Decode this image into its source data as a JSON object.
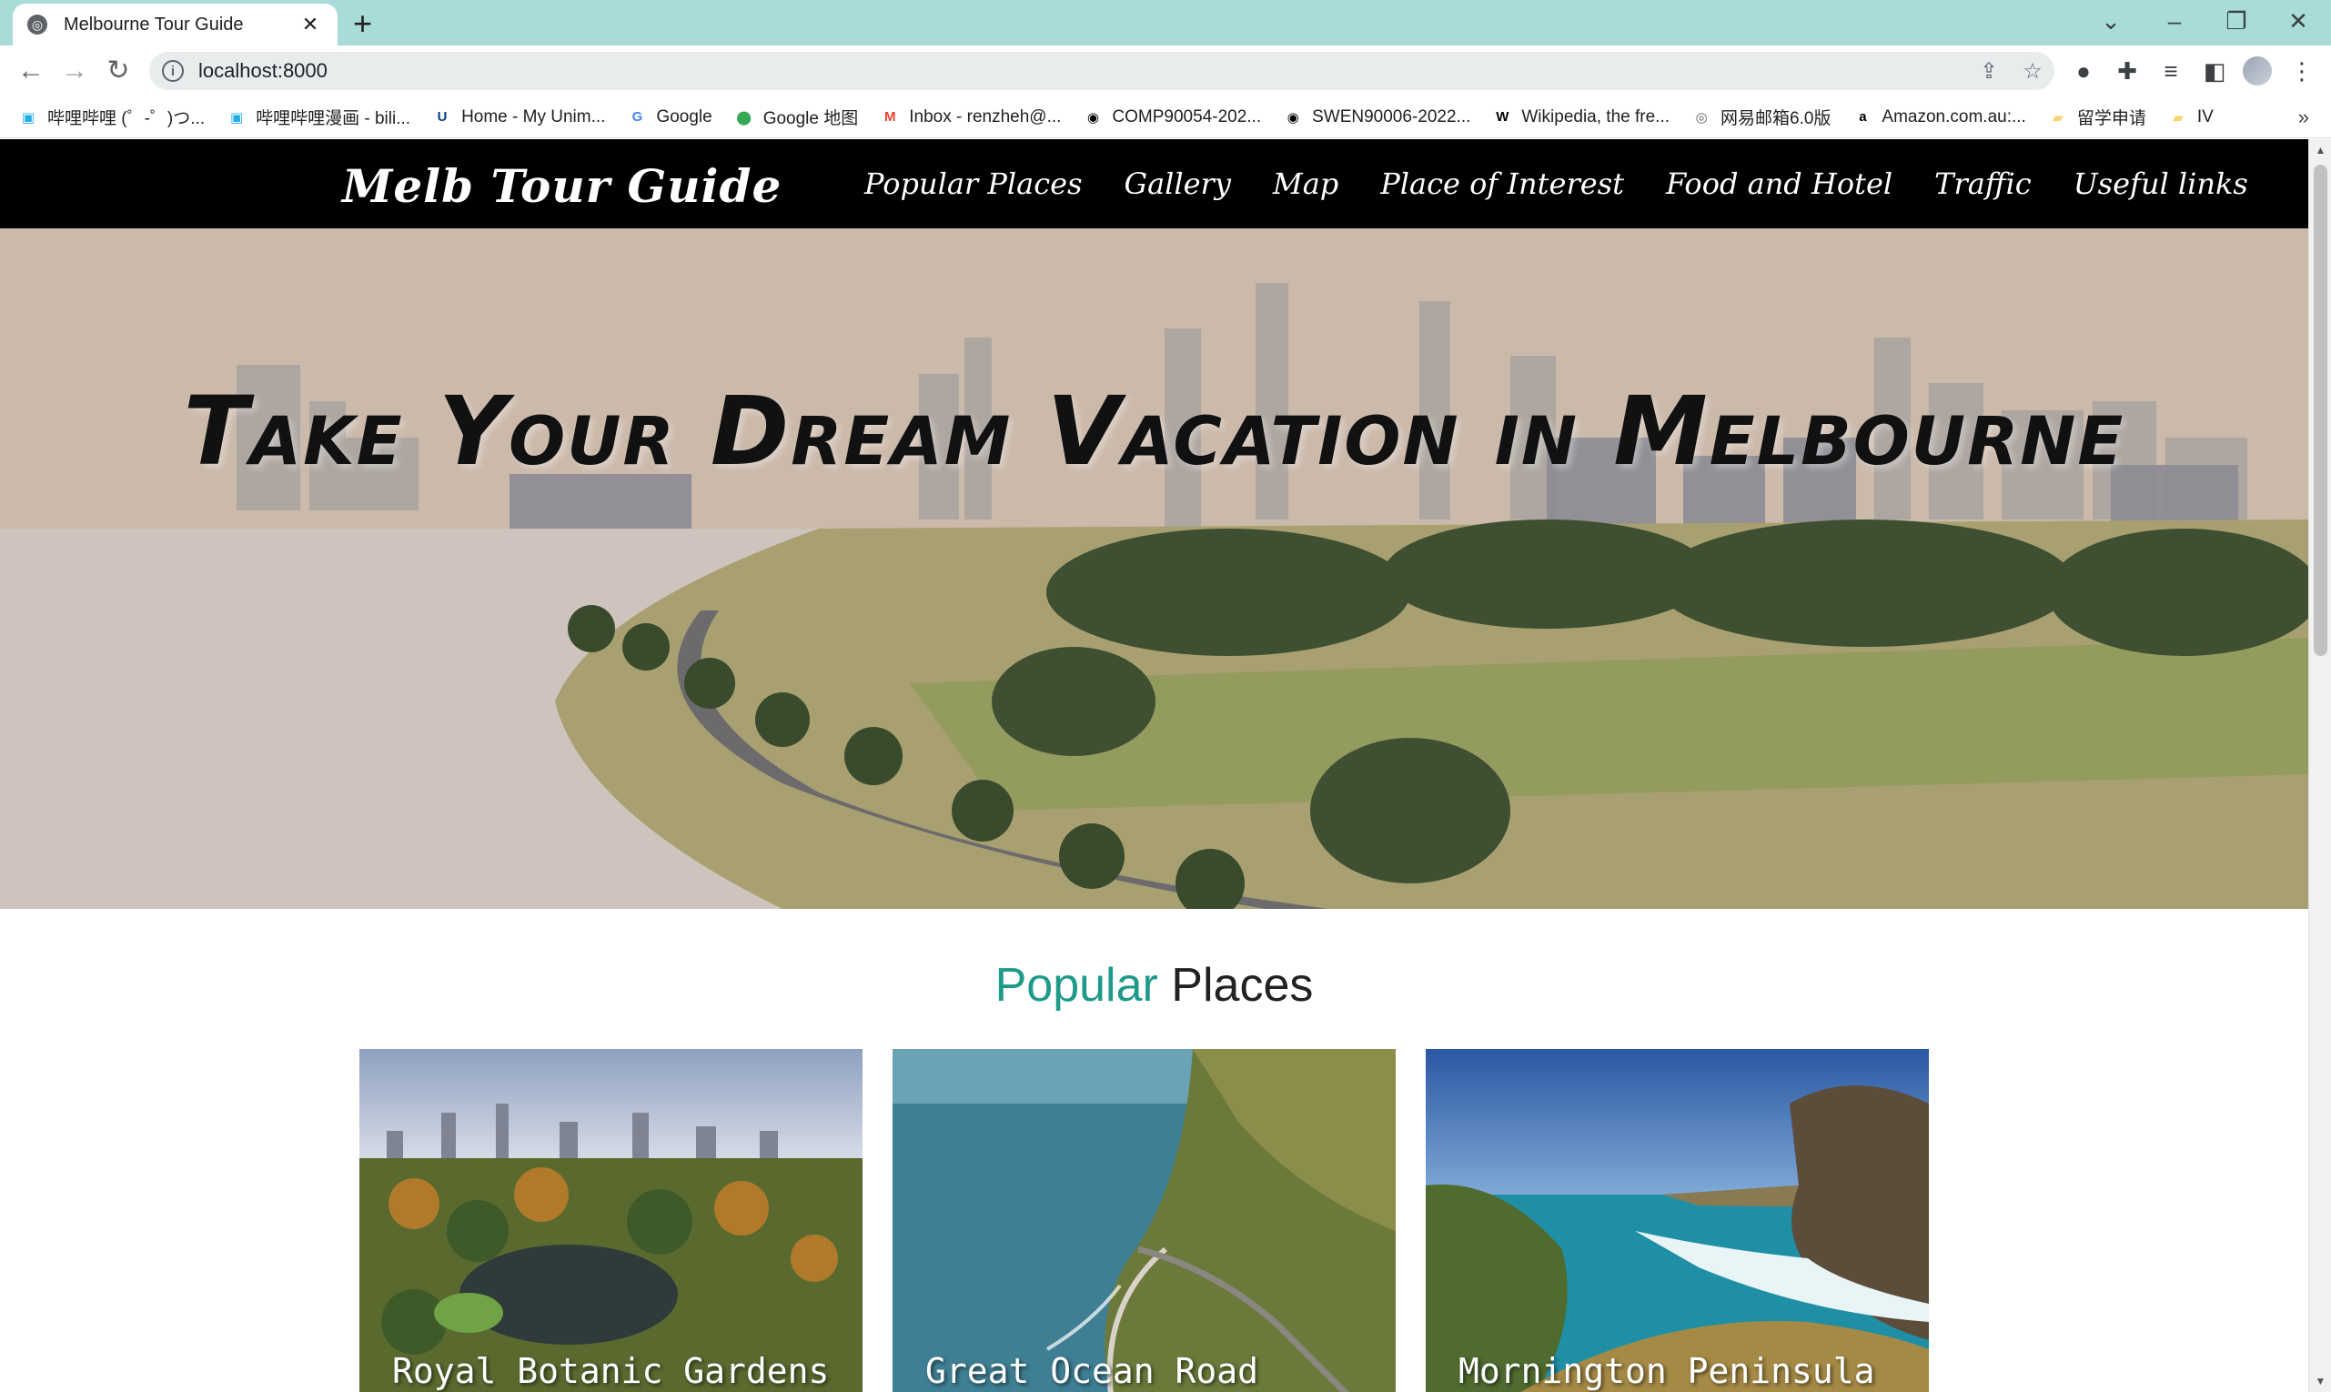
{
  "browser": {
    "tab_title": "Melbourne Tour Guide",
    "url": "localhost:8000",
    "bookmarks": [
      {
        "label": "哔哩哔哩 (゜-゜)つ...",
        "icon": "bilibili-icon",
        "color": "#23ade5"
      },
      {
        "label": "哔哩哔哩漫画 - bili...",
        "icon": "bilibili-icon",
        "color": "#23ade5"
      },
      {
        "label": "Home - My Unim...",
        "icon": "unimelb-icon",
        "color": "#094183"
      },
      {
        "label": "Google",
        "icon": "google-icon",
        "color": "#4285f4"
      },
      {
        "label": "Google 地图",
        "icon": "google-maps-icon",
        "color": "#34a853"
      },
      {
        "label": "Inbox - renzheh@...",
        "icon": "gmail-icon",
        "color": "#ea4335"
      },
      {
        "label": "COMP90054-202...",
        "icon": "github-icon",
        "color": "#000000"
      },
      {
        "label": "SWEN90006-2022...",
        "icon": "github-icon",
        "color": "#000000"
      },
      {
        "label": "Wikipedia, the fre...",
        "icon": "wikipedia-icon",
        "color": "#000000"
      },
      {
        "label": "网易邮箱6.0版",
        "icon": "globe-icon",
        "color": "#5f6368"
      },
      {
        "label": "Amazon.com.au:...",
        "icon": "amazon-icon",
        "color": "#000000"
      },
      {
        "label": "留学申请",
        "icon": "folder-icon",
        "color": "#f9d26a"
      },
      {
        "label": "IV",
        "icon": "folder-icon",
        "color": "#f9d26a"
      }
    ]
  },
  "site": {
    "brand": "Melb Tour Guide",
    "nav": [
      "Popular Places",
      "Gallery",
      "Map",
      "Place of Interest",
      "Food and Hotel",
      "Traffic",
      "Useful links"
    ],
    "hero_title": "Take Your Dream Vacation in Melbourne",
    "section": {
      "accent": "Popular",
      "rest": "Places"
    },
    "cards": [
      "Royal Botanic Gardens",
      "Great Ocean Road",
      "Mornington Peninsula"
    ]
  },
  "colors": {
    "accent": "#1d9a8a",
    "nav_bg": "#000000",
    "tab_strip": "#a8dcd9"
  }
}
